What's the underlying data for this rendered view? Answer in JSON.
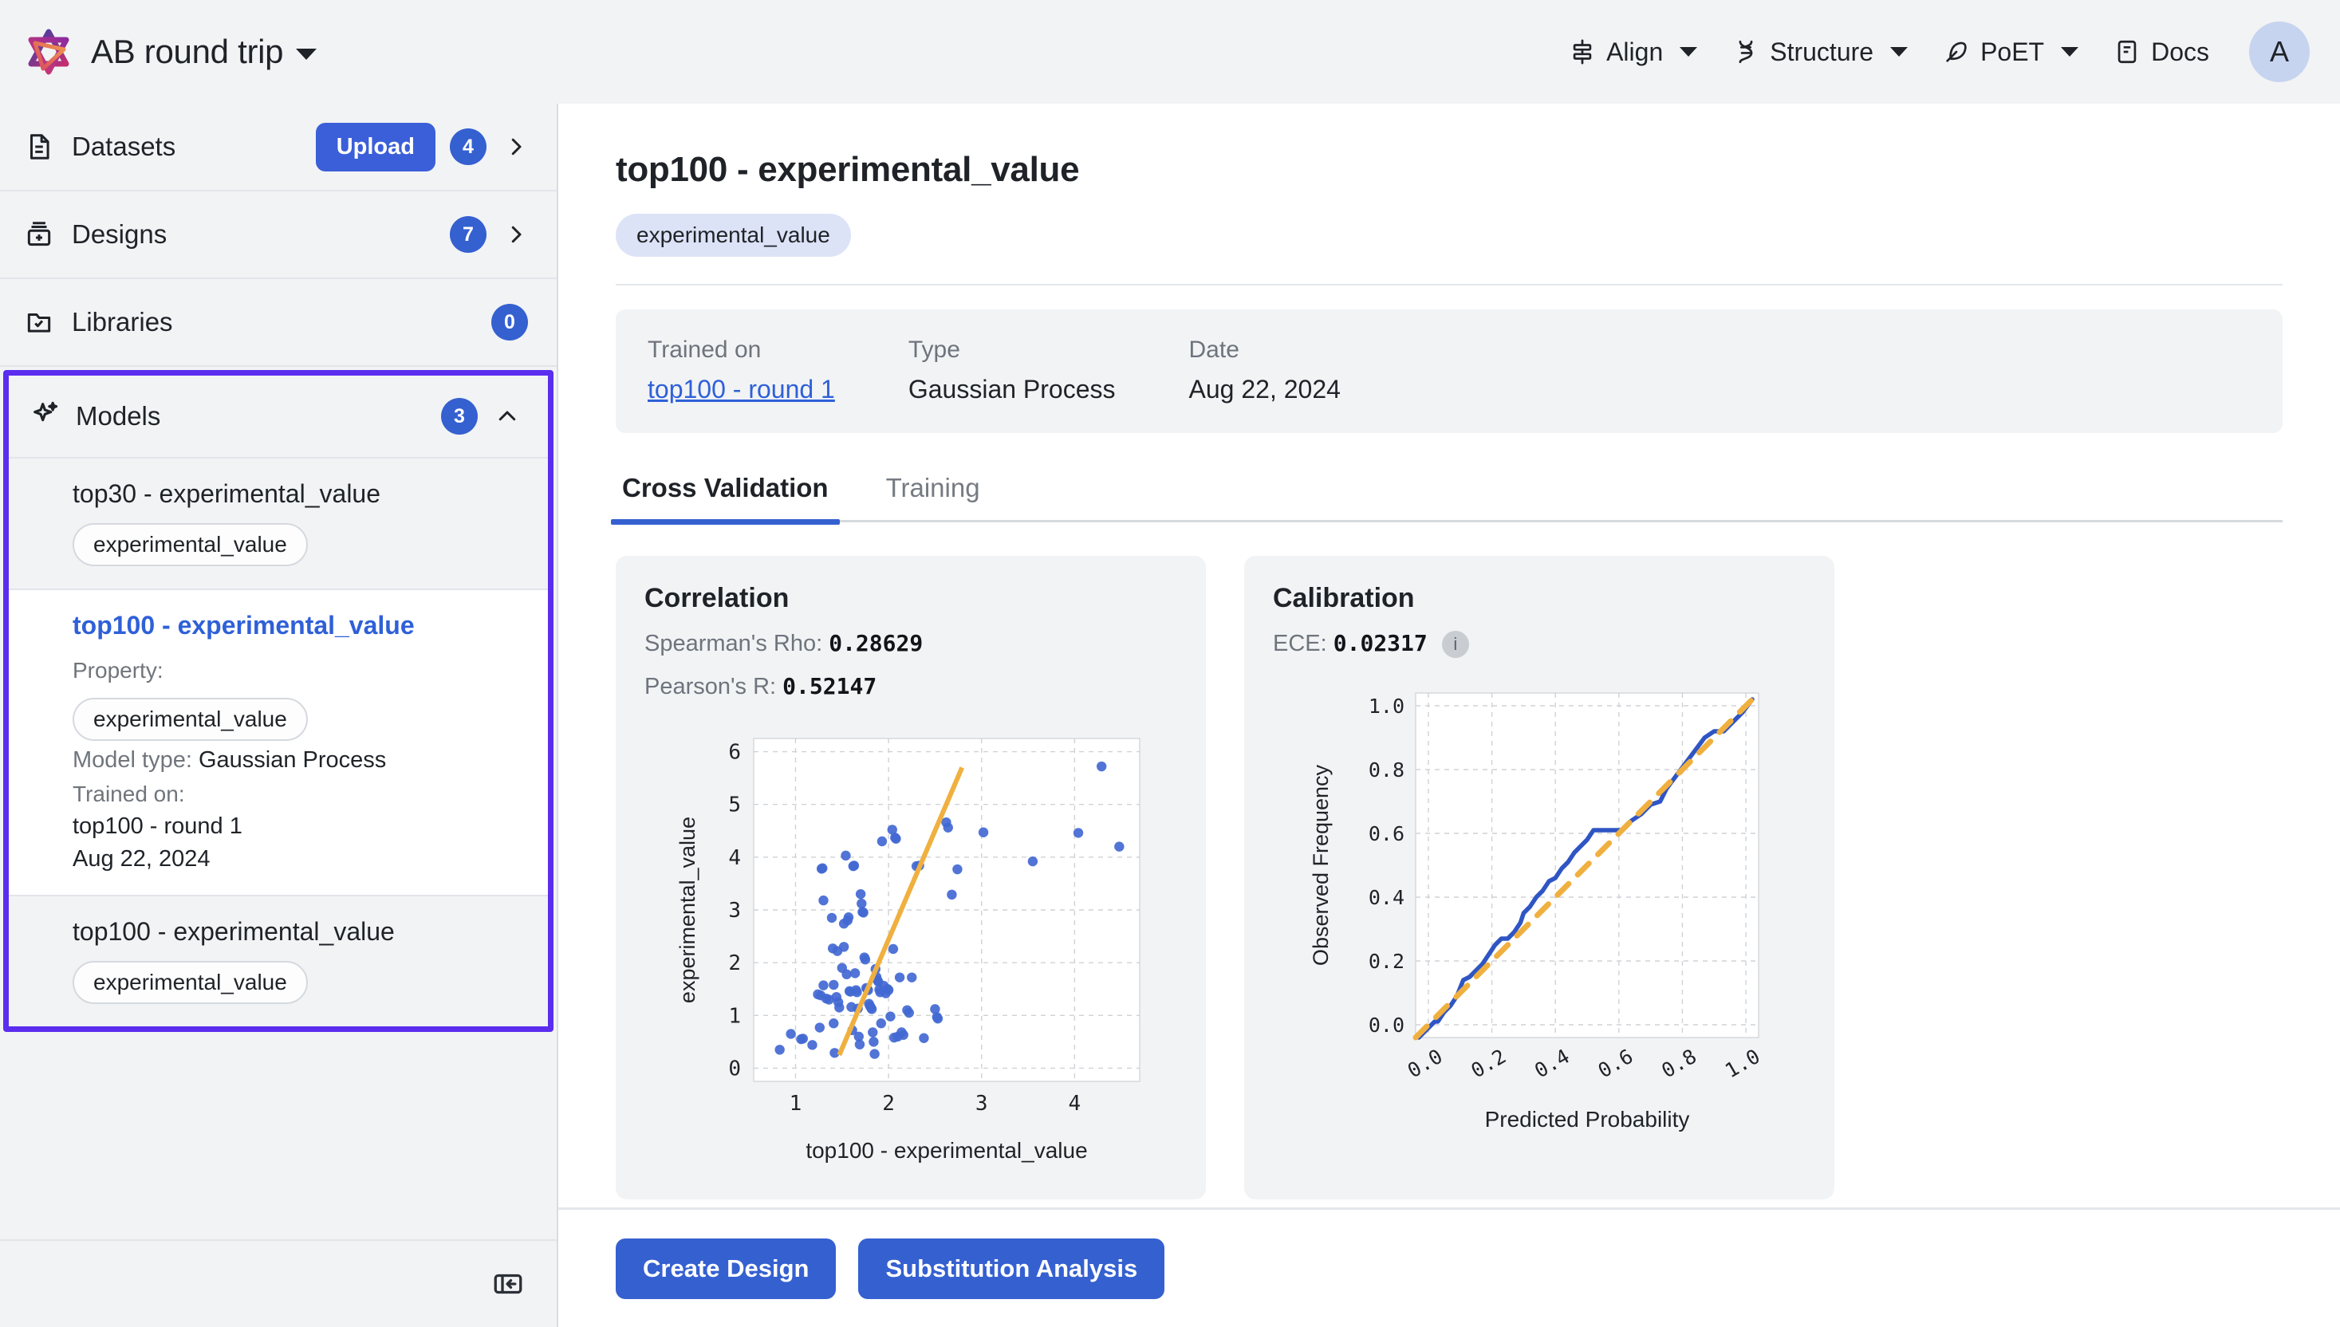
{
  "topbar": {
    "logo_icon": "openprotein-logo-icon",
    "project_title": "AB round trip",
    "project_caret_icon": "chevron-down-icon",
    "nav": [
      {
        "label": "Align",
        "icon": "align-icon",
        "has_caret": true
      },
      {
        "label": "Structure",
        "icon": "dna-helix-icon",
        "has_caret": true
      },
      {
        "label": "PoET",
        "icon": "feather-icon",
        "has_caret": true
      },
      {
        "label": "Docs",
        "icon": "book-icon",
        "has_caret": false
      }
    ],
    "avatar_initial": "A"
  },
  "sidebar": {
    "rows": [
      {
        "label": "Datasets",
        "icon": "file-document-icon",
        "badge": "4",
        "upload_label": "Upload",
        "chevron": "chevron-right-icon"
      },
      {
        "label": "Designs",
        "icon": "designs-box-icon",
        "badge": "7",
        "chevron": "chevron-right-icon"
      },
      {
        "label": "Libraries",
        "icon": "folder-check-icon",
        "badge": "0"
      }
    ],
    "models": {
      "label": "Models",
      "icon": "sparkle-icon",
      "badge": "3",
      "chevron": "chevron-up-icon",
      "items": [
        {
          "name": "top30 - experimental_value",
          "chip": "experimental_value",
          "selected": false
        },
        {
          "name": "top100 - experimental_value",
          "property_label": "Property:",
          "chip": "experimental_value",
          "model_type_label": "Model type:",
          "model_type_value": "Gaussian Process",
          "trained_on_label": "Trained on:",
          "trained_on_value": "top100 - round 1",
          "date": "Aug 22, 2024",
          "selected": true
        },
        {
          "name": "top100 - experimental_value",
          "chip": "experimental_value",
          "selected": false
        }
      ]
    },
    "collapse_icon": "panel-collapse-left-icon"
  },
  "main": {
    "page_title": "top100 - experimental_value",
    "title_chip": "experimental_value",
    "info": [
      {
        "key": "Trained on",
        "value": "top100 - round 1",
        "is_link": true
      },
      {
        "key": "Type",
        "value": "Gaussian Process",
        "is_link": false
      },
      {
        "key": "Date",
        "value": "Aug 22, 2024",
        "is_link": false
      }
    ],
    "tabs": [
      {
        "label": "Cross Validation",
        "active": true
      },
      {
        "label": "Training",
        "active": false
      }
    ],
    "correlation_card": {
      "title": "Correlation",
      "spearman_label": "Spearman's Rho:",
      "spearman_value": "0.28629",
      "pearson_label": "Pearson's R:",
      "pearson_value": "0.52147"
    },
    "calibration_card": {
      "title": "Calibration",
      "ece_label": "ECE:",
      "ece_value": "0.02317",
      "info_icon": "info-circle-icon",
      "info_glyph": "i"
    },
    "footer": {
      "create_design": "Create Design",
      "substitution_analysis": "Substitution Analysis"
    }
  },
  "colors": {
    "accent_blue": "#3560d0",
    "highlight_purple": "#5b2dee",
    "link_blue": "#2f60d8",
    "scatter_point": "#4268d3",
    "trend_orange": "#f0b03f",
    "panel_gray": "#f1f3f5",
    "avatar_bg": "#c7d4ef"
  },
  "chart_data": [
    {
      "type": "scatter",
      "name": "correlation-scatter",
      "title": "Correlation",
      "xlabel": "top100 - experimental_value",
      "ylabel": "experimental_value",
      "xlim": [
        0.55,
        4.7
      ],
      "ylim": [
        -0.25,
        6.25
      ],
      "xticks": [
        1,
        2,
        3,
        4
      ],
      "yticks": [
        0,
        1,
        2,
        3,
        4,
        5,
        6
      ],
      "grid": true,
      "legend": "none",
      "trendline": {
        "color": "#f0b03f",
        "x": [
          1.47,
          2.79
        ],
        "y": [
          0.25,
          5.7
        ]
      },
      "points": [
        [
          0.83,
          0.35
        ],
        [
          0.95,
          0.65
        ],
        [
          1.06,
          0.55
        ],
        [
          1.08,
          0.56
        ],
        [
          1.18,
          0.44
        ],
        [
          1.26,
          0.77
        ],
        [
          1.28,
          3.78
        ],
        [
          1.29,
          3.79
        ],
        [
          1.3,
          3.18
        ],
        [
          1.3,
          1.57
        ],
        [
          1.24,
          1.4
        ],
        [
          1.27,
          1.38
        ],
        [
          1.33,
          1.32
        ],
        [
          1.36,
          1.3
        ],
        [
          1.39,
          2.85
        ],
        [
          1.4,
          2.27
        ],
        [
          1.41,
          1.58
        ],
        [
          1.41,
          0.85
        ],
        [
          1.42,
          0.29
        ],
        [
          1.44,
          1.35
        ],
        [
          1.45,
          2.22
        ],
        [
          1.46,
          1.25
        ],
        [
          1.47,
          1.15
        ],
        [
          1.5,
          1.9
        ],
        [
          1.52,
          2.3
        ],
        [
          1.52,
          2.74
        ],
        [
          1.54,
          4.03
        ],
        [
          1.55,
          1.78
        ],
        [
          1.56,
          2.8
        ],
        [
          1.57,
          2.86
        ],
        [
          1.58,
          1.46
        ],
        [
          1.59,
          1.45
        ],
        [
          1.6,
          1.16
        ],
        [
          1.61,
          0.72
        ],
        [
          1.62,
          3.83
        ],
        [
          1.63,
          3.84
        ],
        [
          1.64,
          1.8
        ],
        [
          1.65,
          1.48
        ],
        [
          1.66,
          1.44
        ],
        [
          1.67,
          1.13
        ],
        [
          1.68,
          0.6
        ],
        [
          1.69,
          0.45
        ],
        [
          1.7,
          3.3
        ],
        [
          1.71,
          3.12
        ],
        [
          1.72,
          2.96
        ],
        [
          1.73,
          2.95
        ],
        [
          1.74,
          2.1
        ],
        [
          1.75,
          2.06
        ],
        [
          1.76,
          1.52
        ],
        [
          1.77,
          1.5
        ],
        [
          1.78,
          1.48
        ],
        [
          1.79,
          1.22
        ],
        [
          1.8,
          1.18
        ],
        [
          1.81,
          1.15
        ],
        [
          1.82,
          1.12
        ],
        [
          1.83,
          0.68
        ],
        [
          1.84,
          0.5
        ],
        [
          1.85,
          0.27
        ],
        [
          1.86,
          1.88
        ],
        [
          1.87,
          1.73
        ],
        [
          1.88,
          1.67
        ],
        [
          1.89,
          1.64
        ],
        [
          1.9,
          1.49
        ],
        [
          1.91,
          1.44
        ],
        [
          1.92,
          0.85
        ],
        [
          1.93,
          4.3
        ],
        [
          1.95,
          1.56
        ],
        [
          1.97,
          1.42
        ],
        [
          1.99,
          1.5
        ],
        [
          2.0,
          1.48
        ],
        [
          2.02,
          0.98
        ],
        [
          2.04,
          4.52
        ],
        [
          2.05,
          2.26
        ],
        [
          2.06,
          0.58
        ],
        [
          2.07,
          4.37
        ],
        [
          2.08,
          4.35
        ],
        [
          2.1,
          0.6
        ],
        [
          2.12,
          1.72
        ],
        [
          2.14,
          0.68
        ],
        [
          2.16,
          0.63
        ],
        [
          2.2,
          1.1
        ],
        [
          2.22,
          1.05
        ],
        [
          2.25,
          1.72
        ],
        [
          2.3,
          3.83
        ],
        [
          2.33,
          3.84
        ],
        [
          2.38,
          0.57
        ],
        [
          2.5,
          1.12
        ],
        [
          2.52,
          0.97
        ],
        [
          2.53,
          0.94
        ],
        [
          2.62,
          4.66
        ],
        [
          2.64,
          4.56
        ],
        [
          2.68,
          3.29
        ],
        [
          2.74,
          3.77
        ],
        [
          3.02,
          4.47
        ],
        [
          3.55,
          3.92
        ],
        [
          4.04,
          4.46
        ],
        [
          4.29,
          5.72
        ],
        [
          4.48,
          4.2
        ]
      ]
    },
    {
      "type": "line",
      "name": "calibration-curve",
      "title": "Calibration",
      "xlabel": "Predicted Probability",
      "ylabel": "Observed Frequency",
      "xlim": [
        -0.04,
        1.04
      ],
      "ylim": [
        -0.04,
        1.04
      ],
      "xticks": [
        0.0,
        0.2,
        0.4,
        0.6,
        0.8,
        1.0
      ],
      "yticks": [
        0.0,
        0.2,
        0.4,
        0.6,
        0.8,
        1.0
      ],
      "grid": true,
      "legend": "none",
      "series": [
        {
          "name": "observed",
          "color": "#2f55c4",
          "style": "solid",
          "x": [
            -0.03,
            0.0,
            0.02,
            0.03,
            0.05,
            0.06,
            0.07,
            0.09,
            0.11,
            0.13,
            0.15,
            0.17,
            0.19,
            0.21,
            0.23,
            0.25,
            0.27,
            0.29,
            0.3,
            0.32,
            0.34,
            0.36,
            0.38,
            0.4,
            0.42,
            0.44,
            0.46,
            0.48,
            0.5,
            0.52,
            0.55,
            0.58,
            0.61,
            0.64,
            0.67,
            0.7,
            0.73,
            0.75,
            0.78,
            0.81,
            0.84,
            0.87,
            0.9,
            0.93,
            0.96,
            0.99,
            1.02
          ],
          "y": [
            -0.04,
            -0.01,
            0.01,
            0.01,
            0.04,
            0.05,
            0.06,
            0.09,
            0.14,
            0.15,
            0.17,
            0.19,
            0.22,
            0.25,
            0.27,
            0.27,
            0.29,
            0.32,
            0.35,
            0.37,
            0.4,
            0.42,
            0.45,
            0.46,
            0.49,
            0.51,
            0.54,
            0.56,
            0.58,
            0.61,
            0.61,
            0.61,
            0.61,
            0.64,
            0.66,
            0.69,
            0.7,
            0.74,
            0.78,
            0.82,
            0.86,
            0.9,
            0.92,
            0.92,
            0.95,
            0.98,
            1.02
          ]
        },
        {
          "name": "ideal",
          "color": "#f0b03f",
          "style": "dashed",
          "x": [
            -0.04,
            1.03
          ],
          "y": [
            -0.04,
            1.03
          ]
        }
      ]
    }
  ]
}
